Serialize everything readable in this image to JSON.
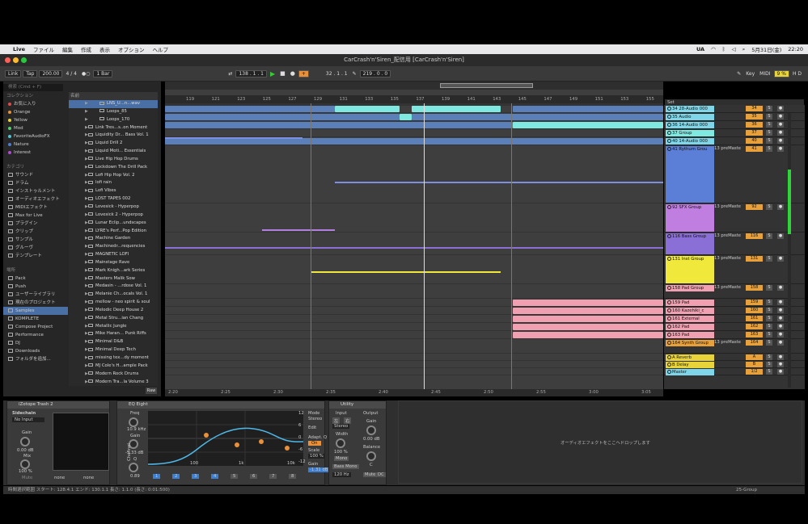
{
  "menubar": {
    "apple": "",
    "app": "Live",
    "items": [
      "ファイル",
      "編集",
      "作成",
      "表示",
      "オプション",
      "ヘルプ"
    ],
    "right_text": "UA",
    "date": "5月31日(金)",
    "time": "22:20"
  },
  "window": {
    "title": "CarCrash'n'Siren_配信用 [CarCrash'n'Siren]"
  },
  "control": {
    "link": "Link",
    "tap": "Tap",
    "tempo": "200.00",
    "sig": "4 / 4",
    "metro": "●○",
    "bar": "1 Bar",
    "pos": "138 . 1 . 1",
    "loop_start": "32 . 1 . 1",
    "loop_len": "219 . 0 . 0",
    "key": "Key",
    "midi": "MIDI",
    "cpu": "9 %"
  },
  "browser": {
    "search_placeholder": "検索 (Cmd + F)",
    "col_header": "名前",
    "sections": {
      "collections": "コレクション",
      "categories": "カテゴリ",
      "places": "場所"
    },
    "collections": [
      {
        "label": "お気に入り",
        "color": "#e24b4b"
      },
      {
        "label": "Orange",
        "color": "#e8903a"
      },
      {
        "label": "Yellow",
        "color": "#e8d43a"
      },
      {
        "label": "Mod",
        "color": "#4bd16a"
      },
      {
        "label": "FavoriteAudioFX",
        "color": "#4bc6d1"
      },
      {
        "label": "Nature",
        "color": "#4b7bd1"
      },
      {
        "label": "Interest",
        "color": "#b04bd1"
      }
    ],
    "categories": [
      "サウンド",
      "ドラム",
      "インストゥルメント",
      "オーディオエフェクト",
      "MIDIエフェクト",
      "Max for Live",
      "プラグイン",
      "クリップ",
      "サンプル",
      "グルーヴ",
      "テンプレート"
    ],
    "places": [
      "Pack",
      "Push",
      "ユーザーライブラリ",
      "現在のプロジェクト",
      "Samples",
      "KOMPLETE",
      "Compose Project",
      "Performance",
      "DJ",
      "Downloads",
      "フォルダを追加..."
    ],
    "files": [
      "LNS_U...n...wav",
      "Loops_85",
      "Loops_170",
      "Link Tres...s..on Moment",
      "Liquidity Dr... Bass Vol. 1",
      "Liquid Drill 2",
      "Liquid Moti... Essentials",
      "Live Hip Hop Drums",
      "Lockdown The Drill Pack",
      "Lofi Hip Hop Vol. 2",
      "lofi rain",
      "Lofi Vibes",
      "LOST TAPES 002",
      "Lovesick - Hyperpop",
      "Lovesick 2 - Hyperpop",
      "Lunar Eclip...undscapes",
      "LYRE's Perf...Pop Edition",
      "Machine Garden",
      "Machinedr...requencies",
      "MAGNETIC LOFI",
      "Mainstage Rave",
      "Mark Knigh...ark Series",
      "Masters Malik Sow",
      "Medasin - ...rdose Vol. 1",
      "Melanie Ch...ocals Vol. 1",
      "mellow - neo spirit & soul",
      "Melodic Deep House 2",
      "Metal Stru...ian Chang",
      "Metallic Jungle",
      "Mike Haran... Punk Riffs",
      "Minimal D&B",
      "Minimal Deep Tech",
      "missing tex...dy moment",
      "MJ Cole's H...ample Pack",
      "Modern Rock Drums",
      "Modern Tra...la Volume 3"
    ],
    "raw": "Raw"
  },
  "ruler": {
    "bars": [
      "119",
      "121",
      "123",
      "125",
      "127",
      "129",
      "131",
      "133",
      "135",
      "137",
      "139",
      "141",
      "143",
      "145",
      "147",
      "149",
      "151",
      "153",
      "155"
    ],
    "times": [
      "2:20",
      "2:25",
      "2:30",
      "2:35",
      "2:40",
      "2:45",
      "2:50",
      "2:55",
      "3:00",
      "3:05"
    ]
  },
  "set_label": "Set",
  "tracks": [
    {
      "name": "34 28-Audio 000",
      "color": "#7fd6e8",
      "vol": "34",
      "h": 10
    },
    {
      "name": "35 Audio",
      "color": "#7fd6e8",
      "vol": "35",
      "h": 10
    },
    {
      "name": "36 14-Audio 000",
      "color": "#7fd6e8",
      "vol": "36",
      "h": 10
    },
    {
      "name": "37 Group",
      "color": "#7fe8e0",
      "vol": "37",
      "h": 10
    },
    {
      "name": "40 14-Audio 000",
      "color": "#7fd6e8",
      "vol": "40",
      "h": 10
    },
    {
      "name": "41 Rythum Grou",
      "color": "#5b7fd6",
      "vol": "41",
      "h": 72,
      "route": "13 preMaste"
    },
    {
      "name": "92 SFX Group",
      "color": "#c07fe0",
      "vol": "92",
      "h": 36,
      "route": "13 preMaste"
    },
    {
      "name": "116 Bass Group",
      "color": "#8a6fd6",
      "vol": "116",
      "h": 28,
      "route": "13 preMaste"
    },
    {
      "name": "131 Inst Group",
      "color": "#f0e83a",
      "vol": "131",
      "h": 36,
      "route": "13 preMaste"
    },
    {
      "name": "158 Pad Group",
      "color": "#f0a0b0",
      "vol": "158",
      "h": 18,
      "route": "13 preMaste"
    },
    {
      "name": "159 Pad",
      "color": "#f0a0b0",
      "vol": "159",
      "h": 10
    },
    {
      "name": "160 Kazehiki_c",
      "color": "#f0a0b0",
      "vol": "160",
      "h": 10
    },
    {
      "name": "161 External",
      "color": "#f0a0b0",
      "vol": "161",
      "h": 10
    },
    {
      "name": "162 Pad",
      "color": "#f0a0b0",
      "vol": "162",
      "h": 10
    },
    {
      "name": "163 Pad",
      "color": "#f0a0b0",
      "vol": "163",
      "h": 10
    },
    {
      "name": "164 Synth Group",
      "color": "#e8a13a",
      "vol": "164",
      "h": 18,
      "route": "13 preMaste"
    },
    {
      "name": "A Reverb",
      "color": "#e8d43a",
      "vol": "A",
      "h": 9
    },
    {
      "name": "B Delay",
      "color": "#e8d43a",
      "vol": "B",
      "h": 9
    },
    {
      "name": "Master",
      "color": "#7fd6e8",
      "vol": "1/2",
      "h": 9
    }
  ],
  "devices": {
    "d1": {
      "title": "iZotope Trash 2",
      "sidechain": "Sidechain",
      "input": "No Input",
      "gain": "Gain",
      "gain_val": "0.00 dB",
      "mix": "Mix",
      "mix_val": "100 %",
      "mute": "Mute",
      "none1": "none",
      "none2": "none"
    },
    "eq": {
      "title": "EQ Eight",
      "freq": "Freq",
      "freq_val": "10.9 kHz",
      "gain": "Gain",
      "gain_val": "-5.33 dB",
      "q": "Q",
      "q_val": "0.89",
      "mode": "Mode",
      "mode_val": "Stereo",
      "edit": "Edit",
      "adapt": "Adapt. Q",
      "on": "On",
      "scale": "Scale",
      "scale_val": "100 %",
      "gain2": "Gain",
      "gain2_val": "-1.31 dB",
      "ylabels": [
        "12",
        "6",
        "0",
        "-6",
        "-12"
      ],
      "xlabels": [
        "100",
        "1k",
        "10k"
      ],
      "channel": "Channel",
      "bands": [
        "1",
        "2",
        "3",
        "4",
        "5",
        "6",
        "7",
        "8"
      ]
    },
    "util": {
      "title": "Utility",
      "input": "Input",
      "output": "Output",
      "left": "左",
      "right": "右",
      "stereo": "Stereo",
      "width": "Width",
      "width_val": "100 %",
      "mono": "Mono",
      "bassmono": "Bass Mono",
      "hz": "120 Hz",
      "gain": "Gain",
      "gain_val": "0.00 dB",
      "balance": "Balance",
      "bal_val": "C",
      "mute": "Mute",
      "dc": "DC"
    },
    "drop_hint": "オーディオエフェクトをここへドロップします"
  },
  "status": {
    "text": "時間選択範囲  スタート: 128.4.1  エンド: 130.1.1  長さ: 1.1.0 (長さ: 0:01:500)",
    "group": "25-Group"
  }
}
